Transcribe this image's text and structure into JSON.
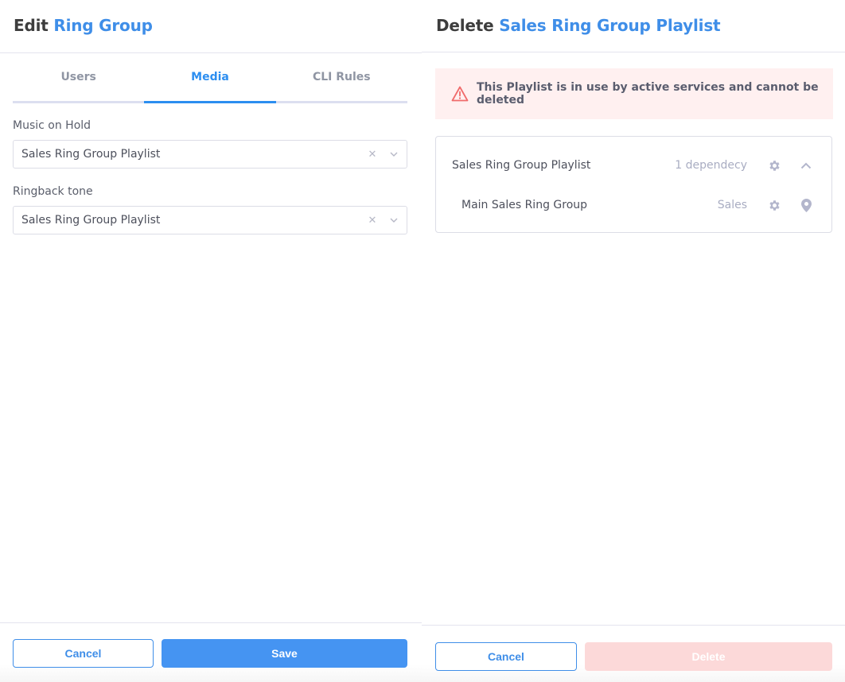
{
  "edit_panel": {
    "title_prefix": "Edit",
    "title_accent": "Ring Group",
    "tabs": [
      {
        "label": "Users",
        "active": false
      },
      {
        "label": "Media",
        "active": true
      },
      {
        "label": "CLI Rules",
        "active": false
      }
    ],
    "fields": [
      {
        "label": "Music on Hold",
        "value": "Sales Ring Group Playlist",
        "clear_icon": "x-icon",
        "dropdown_icon": "chevron-down-icon"
      },
      {
        "label": "Ringback tone",
        "value": "Sales Ring Group Playlist",
        "clear_icon": "x-icon",
        "dropdown_icon": "chevron-down-icon"
      }
    ],
    "footer": {
      "cancel_label": "Cancel",
      "save_label": "Save"
    }
  },
  "delete_panel": {
    "title_prefix": "Delete",
    "title_accent": "Sales Ring Group Playlist",
    "alert": {
      "icon": "warning-triangle-icon",
      "message": "This Playlist is in use by active services and cannot be deleted"
    },
    "dependency_group": {
      "name": "Sales Ring Group Playlist",
      "count_label": "1 dependecy",
      "expanded": true,
      "items": [
        {
          "name": "Main Sales Ring Group",
          "tag": "Sales"
        }
      ]
    },
    "footer": {
      "cancel_label": "Cancel",
      "delete_label": "Delete",
      "delete_disabled": true
    }
  },
  "colors": {
    "accent": "#3f8ee8",
    "tab_active": "#2c8ef0",
    "primary_button": "#4594f2",
    "alert_bg": "#fff0f0",
    "alert_icon": "#f06b6b",
    "delete_disabled": "#fcd9d9",
    "muted_icon": "#b3b6cc"
  }
}
